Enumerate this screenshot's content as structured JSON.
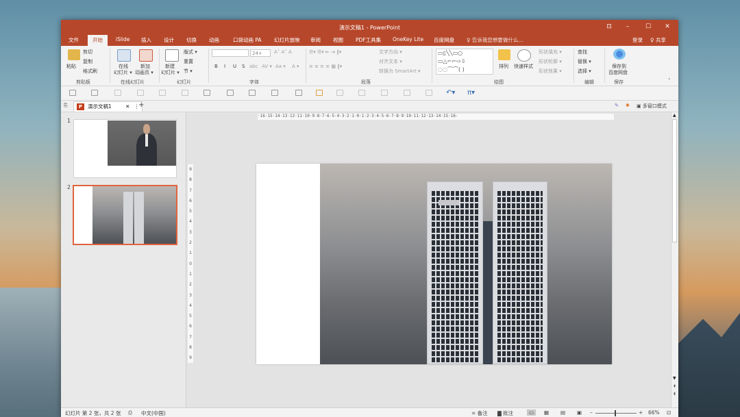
{
  "window": {
    "title": "演示文稿1 - PowerPoint",
    "controls": {
      "ribbon_display": "⊡",
      "minimize": "–",
      "maximize": "☐",
      "close": "✕"
    }
  },
  "menu_tabs": [
    {
      "label": "文件"
    },
    {
      "label": "开始"
    },
    {
      "label": "iSlide"
    },
    {
      "label": "插入"
    },
    {
      "label": "设计"
    },
    {
      "label": "切换"
    },
    {
      "label": "动画"
    },
    {
      "label": "口袋动画 PA"
    },
    {
      "label": "幻灯片放映"
    },
    {
      "label": "审阅"
    },
    {
      "label": "视图"
    },
    {
      "label": "PDF工具集"
    },
    {
      "label": "OneKey Lite"
    },
    {
      "label": "百度网盘"
    }
  ],
  "active_tab": "开始",
  "tell_me": "♀ 告诉我您想要做什么...",
  "account": {
    "login": "登录",
    "share": "♀ 共享"
  },
  "ribbon": {
    "clipboard": {
      "paste": "粘贴",
      "cut": "剪切",
      "copy": "复制",
      "format_painter": "格式刷",
      "label": "剪贴板"
    },
    "online_slides": {
      "online": "在线",
      "online2": "幻灯片 ▾",
      "new": "新加",
      "new2": "动画页 ▾",
      "label": "在线幻灯片"
    },
    "slides": {
      "new_slide": "新建",
      "new_slide2": "幻灯片 ▾",
      "layout": "版式 ▾",
      "reset": "重置",
      "section": "节 ▾",
      "label": "幻灯片"
    },
    "font": {
      "size": "24+",
      "label": "字体",
      "buttons": [
        "B",
        "I",
        "U",
        "S",
        "abc",
        "AV ▾",
        "Aa ▾",
        "A ▾"
      ]
    },
    "paragraph": {
      "text_direction": "文字方向 ▾",
      "align_text": "对齐文本 ▾",
      "smartart": "转换为 SmartArt ▾",
      "label": "段落"
    },
    "drawing": {
      "arrange": "排列",
      "quick_styles": "快速样式",
      "shape_fill": "形状填充 ▾",
      "shape_outline": "形状轮廓 ▾",
      "shape_effects": "形状效果 ▾",
      "label": "绘图"
    },
    "editing": {
      "find": "查找",
      "replace": "替换 ▾",
      "select": "选择 ▾",
      "label": "编辑"
    },
    "save": {
      "save_to": "保存到",
      "save_to2": "百度网盘",
      "label": "保存"
    }
  },
  "document_tab": {
    "name": "演示文稿1",
    "close": "✕",
    "more": "⋮",
    "add": "+"
  },
  "multi_window": "多窗口模式",
  "thumbnails": [
    {
      "number": "1"
    },
    {
      "number": "2"
    }
  ],
  "ruler_h": "·16·15·14·13·12·11·10·9·8·7·6·5·4·3·2·1·0·1·2·3·4·5·6·7·8·9·10·11·12·13·14·15·16·",
  "ruler_v": [
    "9",
    "8",
    "7",
    "6",
    "5",
    "4",
    "3",
    "2",
    "1",
    "0",
    "1",
    "2",
    "3",
    "4",
    "5",
    "6",
    "7",
    "8",
    "9"
  ],
  "status": {
    "slide_info": "幻灯片 第 2 张，共 2 张",
    "language": "中文(中国)",
    "notes": "≐ 备注",
    "comments": "▇ 批注",
    "zoom": "66%"
  },
  "colors": {
    "accent": "#b7472a",
    "selected_thumb_border": "#e0643c"
  }
}
